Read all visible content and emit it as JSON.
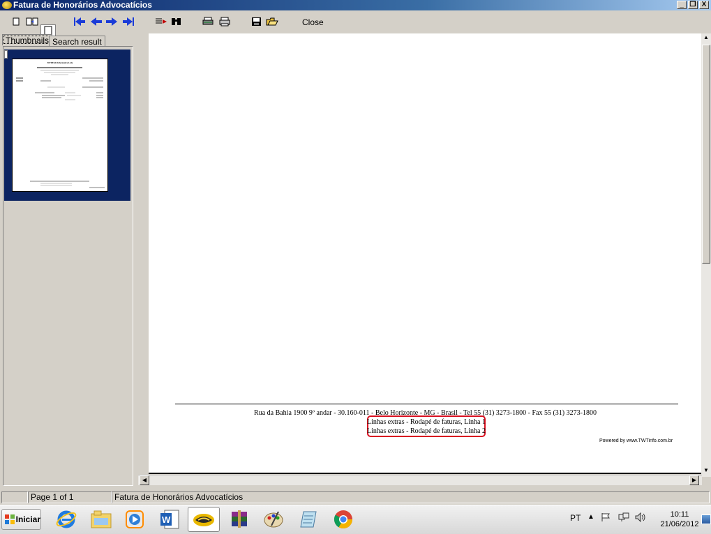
{
  "window": {
    "title": "Fatura de Honorários Advocatícios",
    "controls": [
      "_",
      "❐",
      "X"
    ]
  },
  "toolbar": {
    "close_label": "Close",
    "icons": [
      "single-page-icon",
      "two-page-icon",
      "full-page-icon",
      "first-page-icon",
      "prev-page-icon",
      "next-page-icon",
      "last-page-icon",
      "page-edit-icon",
      "find-icon",
      "print-setup-icon",
      "print-icon",
      "save-icon",
      "open-icon"
    ]
  },
  "tabs": [
    {
      "label": "Thumbnails",
      "active": true
    },
    {
      "label": "Search result",
      "active": false
    }
  ],
  "thumbnail": {
    "title": "MYDEAR Informática Ltda"
  },
  "page": {
    "footer_address": "Rua da Bahia 1900 9º andar  -  30.160-011  -  Belo Horizonte - MG  -  Brasil  -  Tel 55 (31) 3273-1800  -  Fax 55 (31) 3273-1800",
    "extra_line_1": "Linhas extras - Rodapé de faturas, Linha 1",
    "extra_line_2": "Linhas extras - Rodapé de faturas, Linha 2",
    "powered_by": "Powered by www.TWTinfo.com.br",
    "highlight_color": "#d81020"
  },
  "statusbar": {
    "page": "Page 1 of 1",
    "document": "Fatura de Honorários Advocatícios"
  },
  "taskbar": {
    "start_label": "Iniciar",
    "apps": [
      "internet-explorer-icon",
      "file-explorer-icon",
      "media-player-icon",
      "word-icon",
      "handshake-app-icon",
      "winrar-icon",
      "paint-icon",
      "notepad-icon",
      "chrome-icon"
    ],
    "active_app_index": 4,
    "lang": "PT",
    "time": "10:11",
    "date": "21/06/2012"
  }
}
